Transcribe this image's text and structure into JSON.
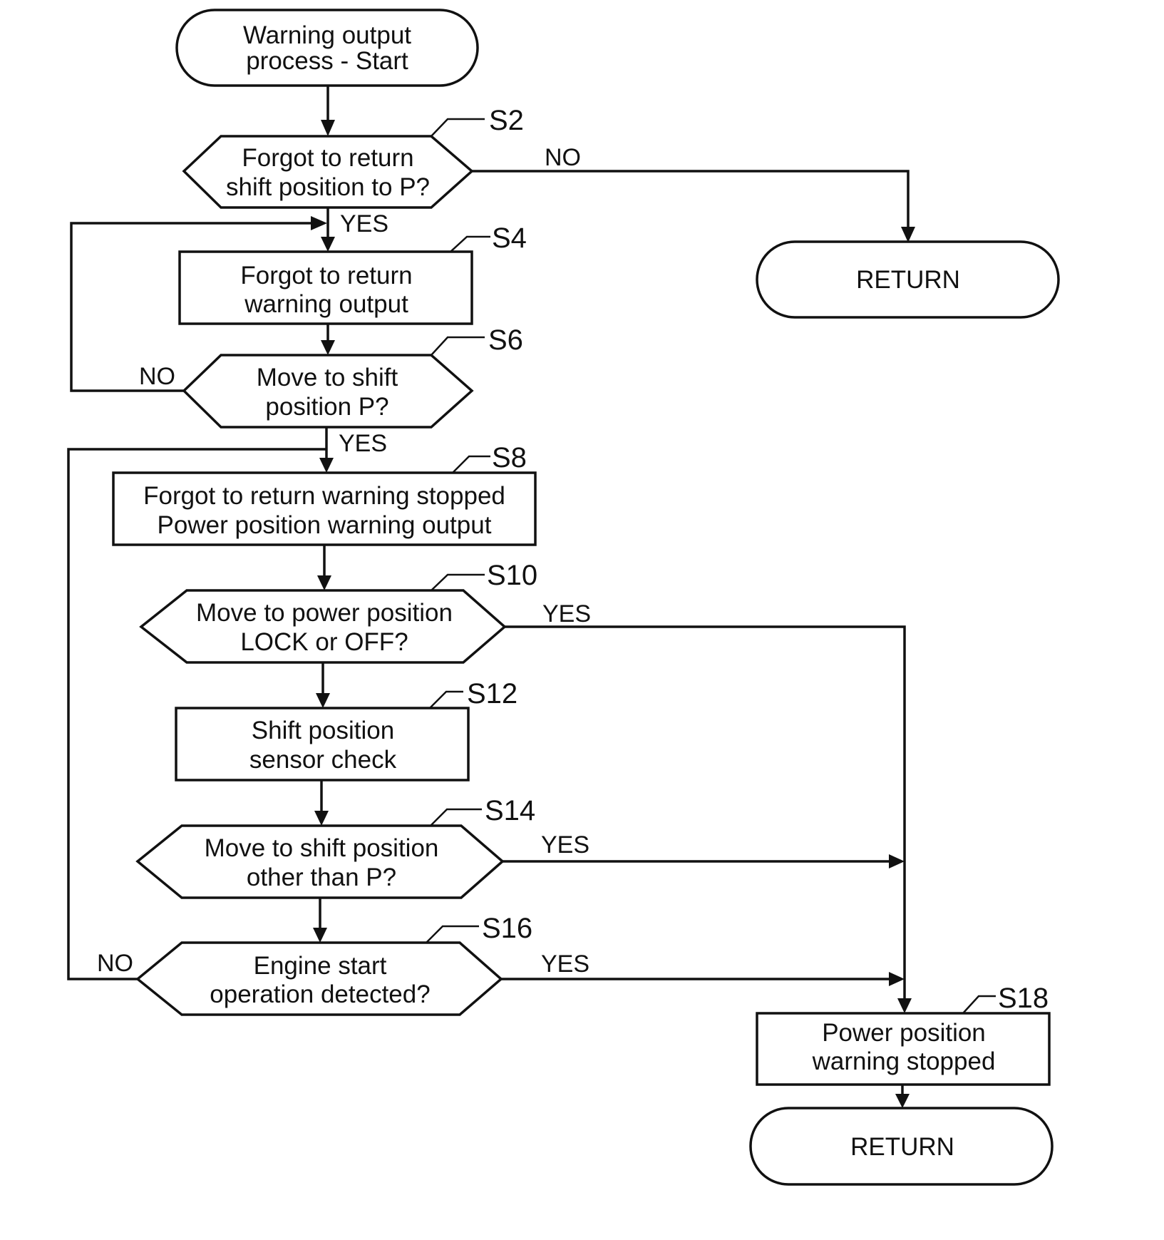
{
  "diagram": {
    "type": "flowchart",
    "nodes": {
      "start": {
        "lines": [
          "Warning output",
          "process - Start"
        ],
        "shape": "terminal"
      },
      "s2": {
        "step": "S2",
        "lines": [
          "Forgot to return",
          "shift position to P?"
        ],
        "shape": "decision"
      },
      "return_top": {
        "lines": [
          "RETURN"
        ],
        "shape": "terminal"
      },
      "s4": {
        "step": "S4",
        "lines": [
          "Forgot to return",
          "warning output"
        ],
        "shape": "process"
      },
      "s6": {
        "step": "S6",
        "lines": [
          "Move to shift",
          "position P?"
        ],
        "shape": "decision"
      },
      "s8": {
        "step": "S8",
        "lines": [
          "Forgot to return warning stopped",
          "Power position warning output"
        ],
        "shape": "process"
      },
      "s10": {
        "step": "S10",
        "lines": [
          "Move to power position",
          "LOCK or OFF?"
        ],
        "shape": "decision"
      },
      "s12": {
        "step": "S12",
        "lines": [
          "Shift position",
          "sensor check"
        ],
        "shape": "process"
      },
      "s14": {
        "step": "S14",
        "lines": [
          "Move to shift position",
          "other than P?"
        ],
        "shape": "decision"
      },
      "s16": {
        "step": "S16",
        "lines": [
          "Engine start",
          "operation detected?"
        ],
        "shape": "decision"
      },
      "s18": {
        "step": "S18",
        "lines": [
          "Power position",
          "warning stopped"
        ],
        "shape": "process"
      },
      "return_bottom": {
        "lines": [
          "RETURN"
        ],
        "shape": "terminal"
      }
    },
    "edges": [
      {
        "from": "start",
        "to": "s2",
        "label": ""
      },
      {
        "from": "s2",
        "to": "return_top",
        "label": "NO"
      },
      {
        "from": "s2",
        "to": "s4",
        "label": "YES"
      },
      {
        "from": "s4",
        "to": "s6",
        "label": ""
      },
      {
        "from": "s6",
        "to": "s4",
        "label": "NO"
      },
      {
        "from": "s6",
        "to": "s8",
        "label": "YES"
      },
      {
        "from": "s8",
        "to": "s10",
        "label": ""
      },
      {
        "from": "s10",
        "to": "s18",
        "label": "YES"
      },
      {
        "from": "s10",
        "to": "s12",
        "label": ""
      },
      {
        "from": "s12",
        "to": "s14",
        "label": ""
      },
      {
        "from": "s14",
        "to": "s18",
        "label": "YES"
      },
      {
        "from": "s14",
        "to": "s16",
        "label": ""
      },
      {
        "from": "s16",
        "to": "s18",
        "label": "YES"
      },
      {
        "from": "s16",
        "to": "s8",
        "label": "NO"
      },
      {
        "from": "s18",
        "to": "return_bottom",
        "label": ""
      }
    ],
    "labels": {
      "yes": "YES",
      "no": "NO"
    }
  }
}
